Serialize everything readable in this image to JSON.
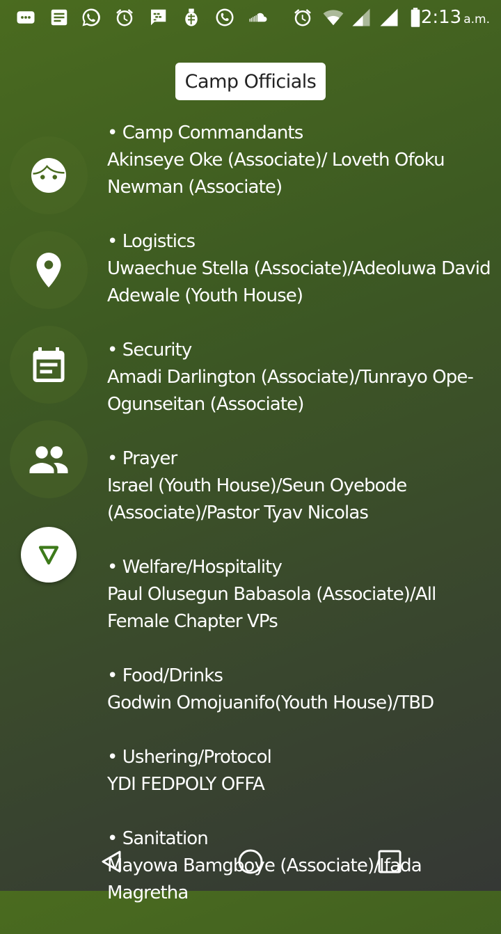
{
  "status_bar": {
    "time": "2:13",
    "ampm": "a.m.",
    "icons": [
      "messages-icon",
      "notes-icon",
      "whatsapp-icon",
      "alarm-icon",
      "bbm-icon",
      "grenade-app-icon",
      "call-app-icon",
      "soundcloud-icon",
      "alarm-icon",
      "wifi-icon",
      "signal-icon",
      "signal-icon",
      "battery-icon"
    ]
  },
  "header": {
    "title": "Camp Officials"
  },
  "side_menu": {
    "items": [
      "face-icon",
      "location-icon",
      "calendar-icon",
      "people-icon"
    ],
    "fab": "triangle-down-icon",
    "accent": "#3d7a1a"
  },
  "sections": [
    {
      "title": "• Camp Commandants",
      "body": "Akinseye Oke (Associate)/ Loveth Ofoku Newman (Associate)"
    },
    {
      "title": "• Logistics",
      "body": "Uwaechue Stella (Associate)/Adeoluwa David Adewale (Youth House)"
    },
    {
      "title": "• Security",
      "body": "Amadi Darlington (Associate)/Tunrayo Ope-Ogunseitan (Associate)"
    },
    {
      "title": "• Prayer",
      "body": "Israel (Youth House)/Seun Oyebode (Associate)/Pastor Tyav Nicolas"
    },
    {
      "title": "• Welfare/Hospitality",
      "body": "Paul Olusegun Babasola (Associate)/All Female Chapter VPs"
    },
    {
      "title": "• Food/Drinks",
      "body": "Godwin Omojuanifo(Youth House)/TBD"
    },
    {
      "title": "• Ushering/Protocol",
      "body": "YDI FEDPOLY OFFA"
    },
    {
      "title": "• Sanitation",
      "body": "Mayowa Bamgboye (Associate)/Ifada Magretha"
    }
  ],
  "nav_bar": [
    "back-icon",
    "home-icon",
    "recents-icon"
  ]
}
